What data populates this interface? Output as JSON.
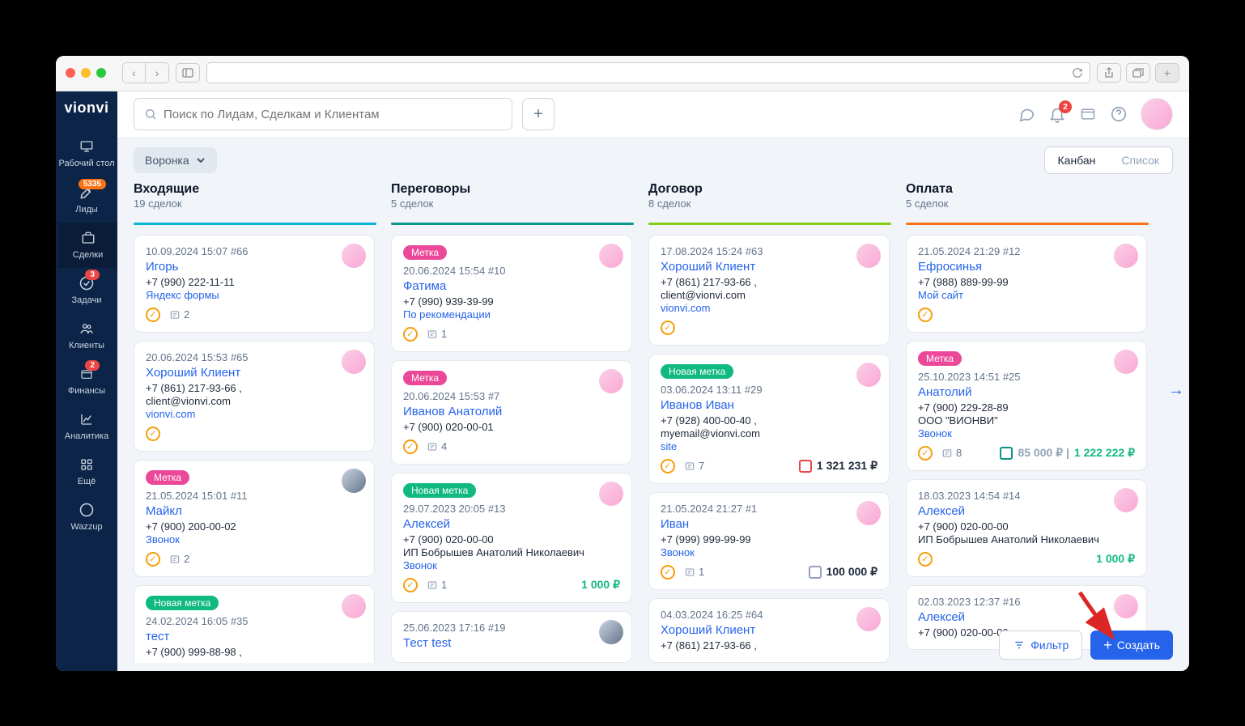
{
  "app_name": "vionvi",
  "search_placeholder": "Поиск по Лидам, Сделкам и Клиентам",
  "notif_count": "2",
  "sidebar": {
    "items": [
      {
        "label": "Рабочий стол",
        "badge": null
      },
      {
        "label": "Лиды",
        "badge": "5335"
      },
      {
        "label": "Сделки",
        "badge": null
      },
      {
        "label": "Задачи",
        "badge": "3"
      },
      {
        "label": "Клиенты",
        "badge": null
      },
      {
        "label": "Финансы",
        "badge": "2"
      },
      {
        "label": "Аналитика",
        "badge": null
      },
      {
        "label": "Ещё",
        "badge": null
      },
      {
        "label": "Wazzup",
        "badge": null
      }
    ]
  },
  "funnel_label": "Воронка",
  "view": {
    "kanban": "Канбан",
    "list": "Список"
  },
  "columns": [
    {
      "title": "Входящие",
      "sub": "19 сделок",
      "color": "#06b6d4"
    },
    {
      "title": "Переговоры",
      "sub": "5 сделок",
      "color": "#0d9488"
    },
    {
      "title": "Договор",
      "sub": "8 сделок",
      "color": "#84cc16"
    },
    {
      "title": "Оплата",
      "sub": "5 сделок",
      "color": "#f97316"
    }
  ],
  "cards": {
    "c0": [
      {
        "meta": "10.09.2024 15:07 #66",
        "name": "Игорь",
        "lines": [
          "+7 (990) 222-11-11"
        ],
        "link": "Яндекс формы",
        "notes": "2"
      },
      {
        "meta": "20.06.2024 15:53 #65",
        "name": "Хороший Клиент",
        "lines": [
          "+7 (861) 217-93-66 ,",
          "client@vionvi.com"
        ],
        "link": "vionvi.com"
      },
      {
        "tag": "Метка",
        "tagcolor": "pink",
        "meta": "21.05.2024 15:01 #11",
        "name": "Майкл",
        "lines": [
          "+7 (900) 200-00-02"
        ],
        "link": "Звонок",
        "notes": "2",
        "av": "m"
      },
      {
        "tag": "Новая метка",
        "tagcolor": "green",
        "meta": "24.02.2024 16:05 #35",
        "name": "тест",
        "lines": [
          "+7 (900) 999-88-98 ,"
        ]
      }
    ],
    "c1": [
      {
        "tag": "Метка",
        "tagcolor": "pink",
        "meta": "20.06.2024 15:54 #10",
        "name": "Фатима",
        "lines": [
          "+7 (990) 939-39-99"
        ],
        "link": "По рекомендации",
        "notes": "1"
      },
      {
        "tag": "Метка",
        "tagcolor": "pink",
        "meta": "20.06.2024 15:53 #7",
        "name": "Иванов Анатолий",
        "lines": [
          "+7 (900) 020-00-01"
        ],
        "notes": "4"
      },
      {
        "tag": "Новая метка",
        "tagcolor": "green",
        "meta": "29.07.2023 20:05 #13",
        "name": "Алексей",
        "lines": [
          "+7 (900) 020-00-00",
          "ИП Бобрышев Анатолий Николаевич"
        ],
        "link": "Звонок",
        "notes": "1",
        "amount": "1 000 ₽",
        "amtclass": "amt-green"
      },
      {
        "meta": "25.06.2023 17:16 #19",
        "name": "Тест test",
        "av": "m"
      }
    ],
    "c2": [
      {
        "meta": "17.08.2024 15:24 #63",
        "name": "Хороший Клиент",
        "lines": [
          "+7 (861) 217-93-66 ,",
          "client@vionvi.com"
        ],
        "link": "vionvi.com"
      },
      {
        "tag": "Новая метка",
        "tagcolor": "green",
        "meta": "03.06.2024 13:11 #29",
        "name": "Иванов Иван",
        "lines": [
          "+7 (928) 400-00-40 ,",
          "myemail@vionvi.com"
        ],
        "link": "site",
        "notes": "7",
        "amount": "1 321 231 ₽",
        "amtclass": "amt-dark",
        "cal": "red"
      },
      {
        "meta": "21.05.2024 21:27 #1",
        "name": "Иван",
        "lines": [
          "+7 (999) 999-99-99"
        ],
        "link": "Звонок",
        "notes": "1",
        "amount": "100 000 ₽",
        "amtclass": "amt-dark",
        "cal": "gray"
      },
      {
        "meta": "04.03.2024 16:25 #64",
        "name": "Хороший Клиент",
        "lines": [
          "+7 (861) 217-93-66 ,"
        ]
      }
    ],
    "c3": [
      {
        "meta": "21.05.2024 21:29 #12",
        "name": "Ефросинья",
        "lines": [
          "+7 (988) 889-99-99"
        ],
        "link": "Мой сайт"
      },
      {
        "tag": "Метка",
        "tagcolor": "pink",
        "meta": "25.10.2023 14:51 #25",
        "name": "Анатолий",
        "lines": [
          "+7 (900) 229-28-89",
          "ООО \"ВИОНВИ\""
        ],
        "link": "Звонок",
        "notes": "8",
        "amount": "85 000 ₽ |",
        "amount2": "1 222 222 ₽",
        "cal": "teal"
      },
      {
        "meta": "18.03.2023 14:54 #14",
        "name": "Алексей",
        "lines": [
          "+7 (900) 020-00-00",
          "ИП Бобрышев Анатолий Николаевич"
        ],
        "amount": "1 000 ₽",
        "amtclass": "amt-green",
        "onlychk": true
      },
      {
        "meta": "02.03.2023 12:37 #16",
        "name": "Алексей",
        "lines": [
          "+7 (900) 020-00-00"
        ]
      }
    ]
  },
  "filter_label": "Фильтр",
  "create_label": "Создать"
}
